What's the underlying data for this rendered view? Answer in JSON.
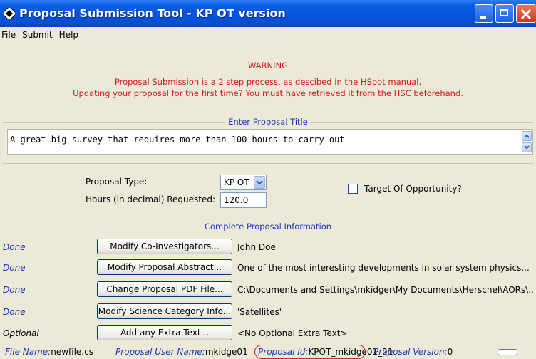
{
  "window": {
    "title": "Proposal Submission Tool - KP OT version"
  },
  "menu": [
    "File",
    "Submit",
    "Help"
  ],
  "warning": {
    "heading": "WARNING",
    "line1": "Proposal Submission is a 2 step process, as descibed in the HSpot manual.",
    "line2": "Updating your proposal for the first time? You must have retrieved it from the HSC beforehand."
  },
  "title_section": {
    "heading": "Enter Proposal Title",
    "value": "A great big survey that requires more than 100 hours to carry out"
  },
  "proposal": {
    "type_label": "Proposal Type:",
    "type_value": "KP OT",
    "hours_label": "Hours (in decimal) Requested:",
    "hours_value": "120.0",
    "too_label": "Target Of Opportunity?"
  },
  "info_section": {
    "heading": "Complete Proposal Information",
    "rows": [
      {
        "status": "Done",
        "button": "Modify Co-Investigators...",
        "value": "John Doe"
      },
      {
        "status": "Done",
        "button": "Modify Proposal Abstract...",
        "value": "One of the most interesting developments in solar system physics..."
      },
      {
        "status": "Done",
        "button": "Change Proposal PDF File...",
        "value": "C:\\Documents and Settings\\mkidger\\My Documents\\Herschel\\AORs\\..."
      },
      {
        "status": "Done",
        "button": "Modify Science Category Info...",
        "value": "'Satellites'"
      },
      {
        "status": "Optional",
        "button": "Add any Extra Text...",
        "value": "<No Optional Extra Text>"
      }
    ]
  },
  "statusbar": {
    "file_label": "File Name:",
    "file_value": "newfile.cs",
    "user_label": "Proposal User Name:",
    "user_value": "mkidge01",
    "id_label": "Proposal Id:",
    "id_value": "KPOT_mkidge01_21",
    "version_label": "Proposal Version:",
    "version_value": "0"
  }
}
